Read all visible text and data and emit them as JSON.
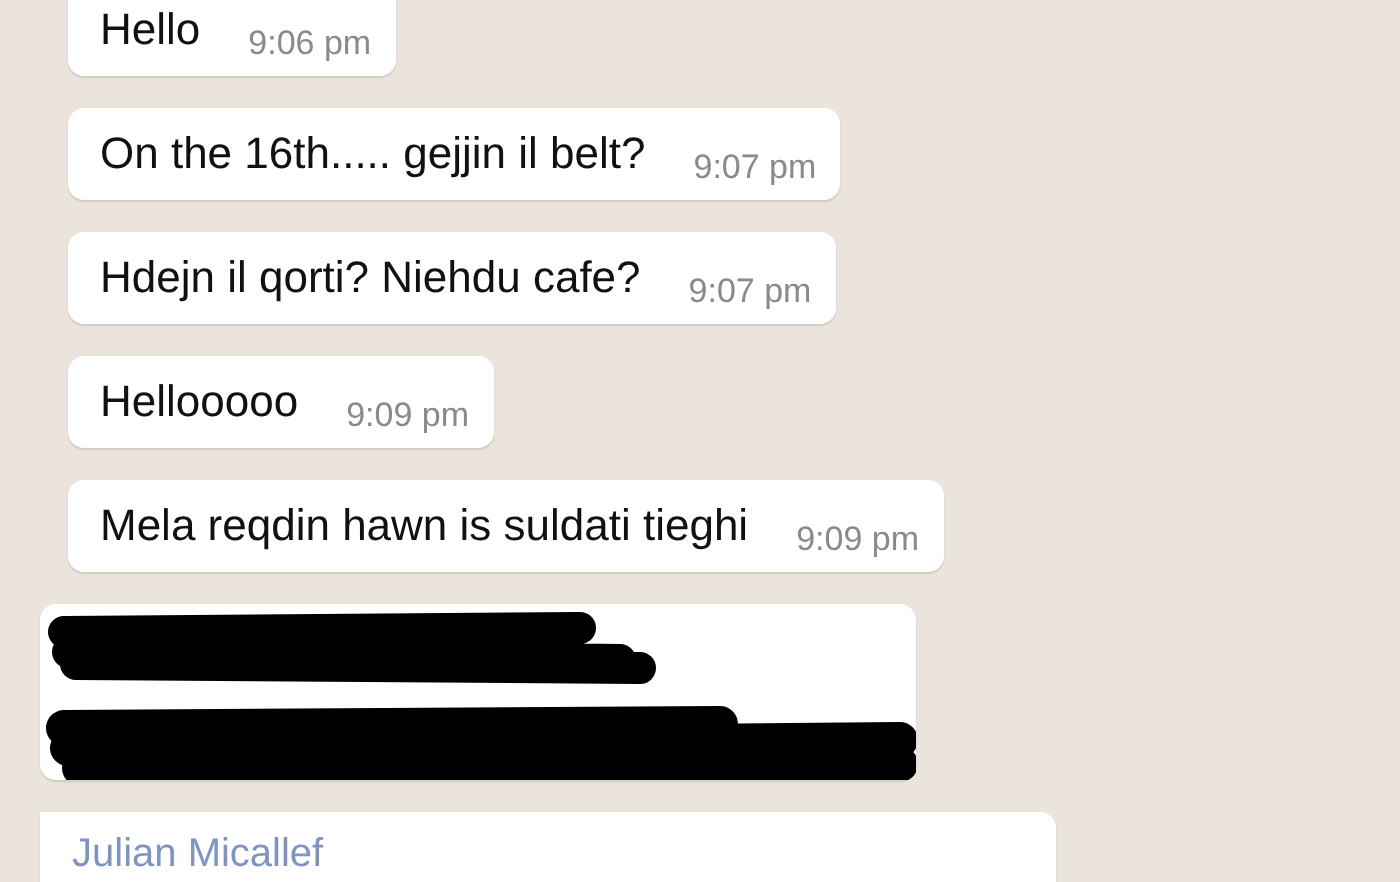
{
  "messages": [
    {
      "kind": "text",
      "text": "Hello",
      "time": "9:06 pm"
    },
    {
      "kind": "text",
      "text": "On the 16th..... gejjin il belt?",
      "time": "9:07 pm"
    },
    {
      "kind": "text",
      "text": "Hdejn il qorti? Niehdu cafe?",
      "time": "9:07 pm"
    },
    {
      "kind": "text",
      "text": "Hellooooo",
      "time": "9:09 pm"
    },
    {
      "kind": "text",
      "text": "Mela reqdin hawn is suldati tieghi",
      "time": "9:09 pm"
    },
    {
      "kind": "redacted"
    },
    {
      "kind": "sender",
      "sender": "Julian Micallef"
    }
  ]
}
